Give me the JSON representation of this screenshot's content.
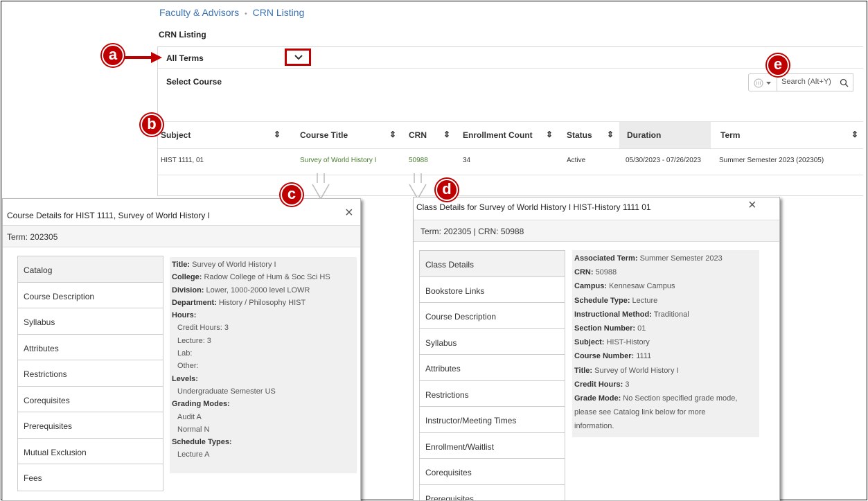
{
  "breadcrumb": {
    "items": [
      "Faculty & Advisors",
      "CRN Listing"
    ],
    "separator": "•"
  },
  "page_title": "CRN Listing",
  "term_filter": {
    "label": "All Terms"
  },
  "select_course_label": "Select Course",
  "search": {
    "placeholder": "Search (Alt+Y)"
  },
  "table": {
    "columns": [
      "Subject",
      "Course Title",
      "CRN",
      "Enrollment Count",
      "Status",
      "Duration",
      "Term"
    ],
    "rows": [
      {
        "subject": "HIST 1111, 01",
        "course_title": "Survey of World History I",
        "crn": "50988",
        "enrollment": "34",
        "status": "Active",
        "duration": "05/30/2023 - 07/26/2023",
        "term": "Summer Semester 2023 (202305)"
      }
    ]
  },
  "callouts": {
    "a": "a",
    "b": "b",
    "c": "c",
    "d": "d",
    "e": "e"
  },
  "course_details": {
    "title": "Course Details for HIST 1111, Survey of World History I",
    "close": "×",
    "term_label": "Term:",
    "term_value": "202305",
    "tabs": [
      "Catalog",
      "Course Description",
      "Syllabus",
      "Attributes",
      "Restrictions",
      "Corequisites",
      "Prerequisites",
      "Mutual Exclusion",
      "Fees"
    ],
    "fields": {
      "title_k": "Title:",
      "title_v": "Survey of World History I",
      "college_k": "College:",
      "college_v": "Radow College of Hum & Soc Sci HS",
      "division_k": "Division:",
      "division_v": "Lower, 1000-2000 level LOWR",
      "department_k": "Department:",
      "department_v": "History / Philosophy HIST",
      "hours_k": "Hours:",
      "credit_hours": "Credit Hours: 3",
      "lecture": "Lecture: 3",
      "lab": "Lab:",
      "other": "Other:",
      "levels_k": "Levels:",
      "levels_v": "Undergraduate Semester US",
      "grading_k": "Grading Modes:",
      "grading_v1": "Audit A",
      "grading_v2": "Normal N",
      "schedule_k": "Schedule Types:",
      "schedule_v": "Lecture A"
    }
  },
  "class_details": {
    "title": "Class Details for Survey of World History I HIST-History 1111 01",
    "close": "×",
    "term_label": "Term:",
    "term_value": "202305",
    "divider": "|",
    "crn_label": "CRN:",
    "crn_value": "50988",
    "tabs": [
      "Class Details",
      "Bookstore Links",
      "Course Description",
      "Syllabus",
      "Attributes",
      "Restrictions",
      "Instructor/Meeting Times",
      "Enrollment/Waitlist",
      "Corequisites",
      "Prerequisites"
    ],
    "fields": {
      "assoc_k": "Associated Term:",
      "assoc_v": "Summer Semester 2023",
      "crn_k": "CRN:",
      "crn_v": "50988",
      "campus_k": "Campus:",
      "campus_v": "Kennesaw Campus",
      "sched_k": "Schedule Type:",
      "sched_v": "Lecture",
      "method_k": "Instructional Method:",
      "method_v": "Traditional",
      "section_k": "Section Number:",
      "section_v": "01",
      "subject_k": "Subject:",
      "subject_v": "HIST-History",
      "course_k": "Course Number:",
      "course_v": "1111",
      "title_k": "Title:",
      "title_v": "Survey of World History I",
      "credit_k": "Credit Hours:",
      "credit_v": "3",
      "grade_k": "Grade Mode:",
      "grade_v1": "No Section specified grade mode,",
      "grade_v2": "please see Catalog link below for more",
      "grade_v3": "information."
    }
  },
  "colors": {
    "callout": "#c00000",
    "link": "#3a73b3",
    "green_link": "#4a7b2f"
  }
}
